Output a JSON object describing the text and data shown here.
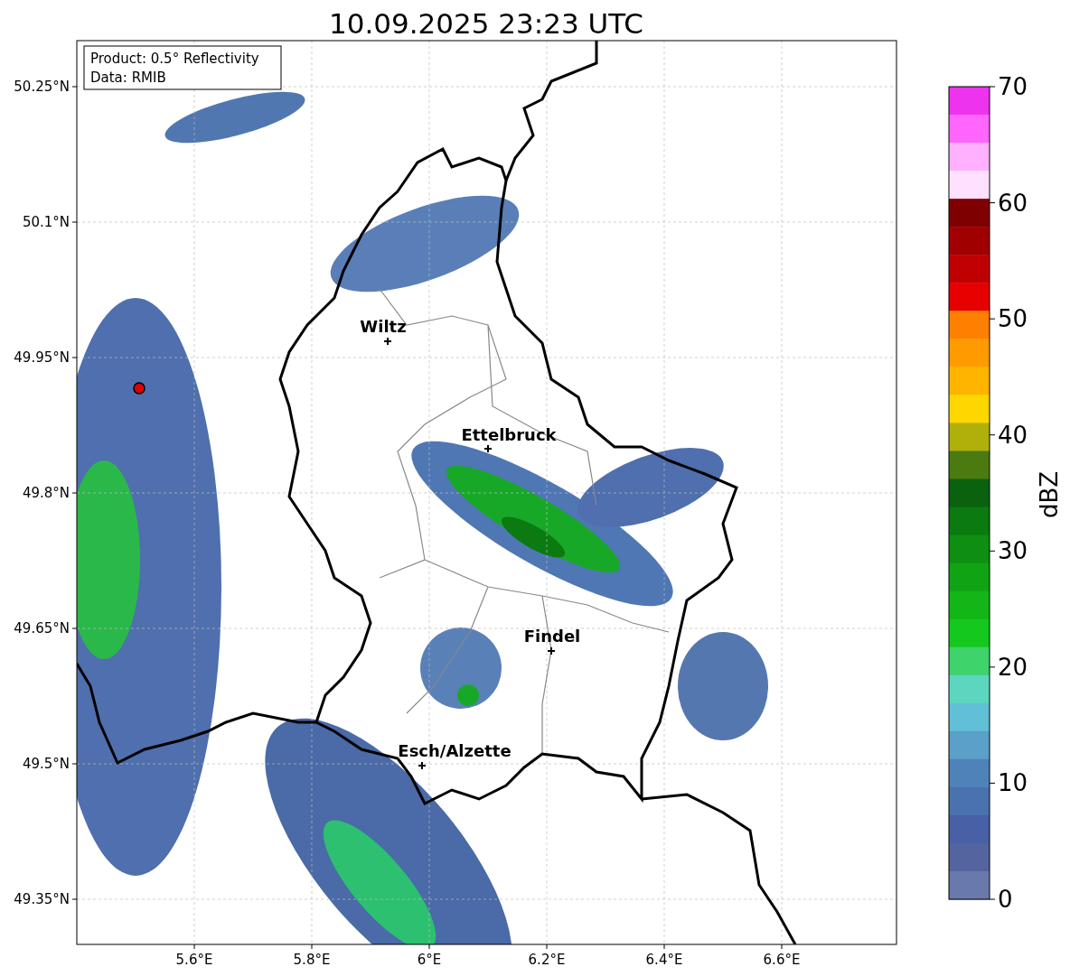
{
  "title": "10.09.2025 23:23 UTC",
  "info_box": [
    "Product: 0.5° Reflectivity",
    "Data: RMIB"
  ],
  "lat_ticks": [
    "50.25°N",
    "50.1°N",
    "49.95°N",
    "49.8°N",
    "49.65°N",
    "49.5°N",
    "49.35°N"
  ],
  "lon_ticks": [
    "5.6°E",
    "5.8°E",
    "6°E",
    "6.2°E",
    "6.4°E",
    "6.6°E"
  ],
  "places": [
    {
      "name": "Wiltz"
    },
    {
      "name": "Ettelbruck"
    },
    {
      "name": "Findel"
    },
    {
      "name": "Esch/Alzette"
    }
  ],
  "colorbar": {
    "label": "dBZ",
    "ticks": [
      "70",
      "60",
      "50",
      "40",
      "30",
      "20",
      "10",
      "0"
    ],
    "segments": [
      {
        "color": "#ee33ee"
      },
      {
        "color": "#ff66ff"
      },
      {
        "color": "#ffb0ff"
      },
      {
        "color": "#ffe0ff"
      },
      {
        "color": "#7f0000"
      },
      {
        "color": "#a00000"
      },
      {
        "color": "#c00000"
      },
      {
        "color": "#e60000"
      },
      {
        "color": "#ff7f00"
      },
      {
        "color": "#ff9b00"
      },
      {
        "color": "#ffb400"
      },
      {
        "color": "#ffd700"
      },
      {
        "color": "#b0b00a"
      },
      {
        "color": "#4a7a10"
      },
      {
        "color": "#0a620e"
      },
      {
        "color": "#0b7a10"
      },
      {
        "color": "#0e8f12"
      },
      {
        "color": "#10a314"
      },
      {
        "color": "#12b617"
      },
      {
        "color": "#14c81e"
      },
      {
        "color": "#3ed36b"
      },
      {
        "color": "#5dd6c0"
      },
      {
        "color": "#62bfd8"
      },
      {
        "color": "#5aa0c8"
      },
      {
        "color": "#4f82b8"
      },
      {
        "color": "#4a72ae"
      },
      {
        "color": "#4760a6"
      },
      {
        "color": "#53649e"
      },
      {
        "color": "#6a79ab"
      }
    ]
  }
}
